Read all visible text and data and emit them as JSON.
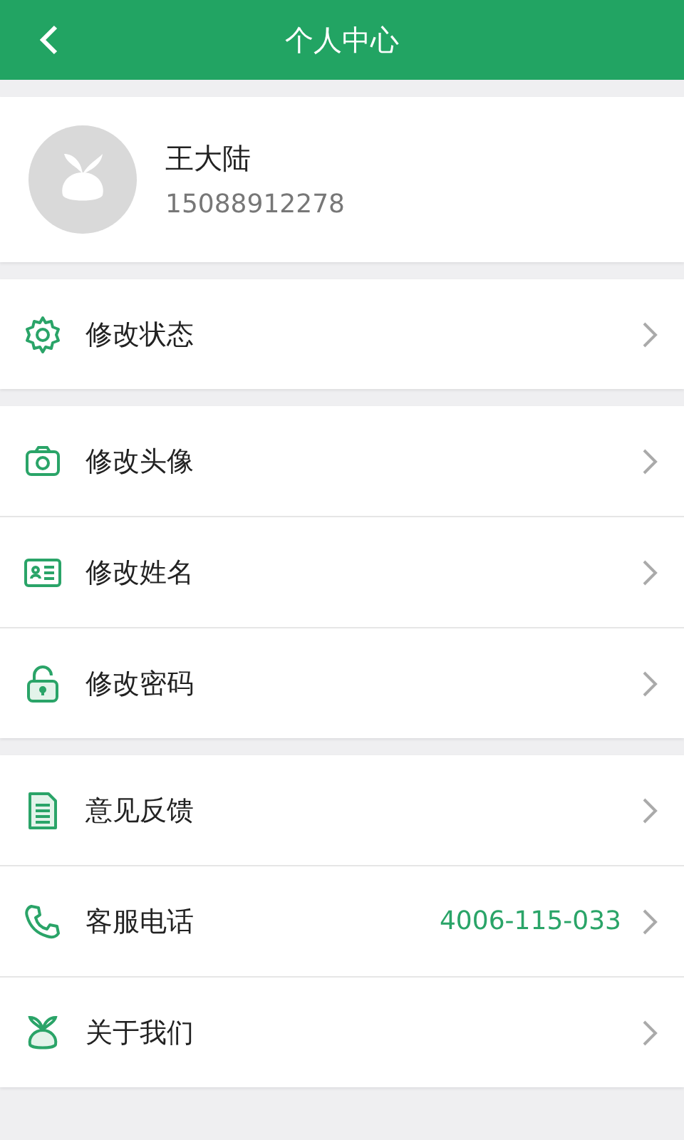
{
  "header": {
    "title": "个人中心"
  },
  "profile": {
    "name": "王大陆",
    "phone": "15088912278"
  },
  "groups": [
    [
      {
        "kind": "gear",
        "label": "修改状态"
      }
    ],
    [
      {
        "kind": "camera",
        "label": "修改头像"
      },
      {
        "kind": "idcard",
        "label": "修改姓名"
      },
      {
        "kind": "lock",
        "label": "修改密码"
      }
    ],
    [
      {
        "kind": "document",
        "label": "意见反馈"
      },
      {
        "kind": "phone",
        "label": "客服电话",
        "value": "4006-115-033"
      },
      {
        "kind": "sprout",
        "label": "关于我们"
      }
    ]
  ]
}
